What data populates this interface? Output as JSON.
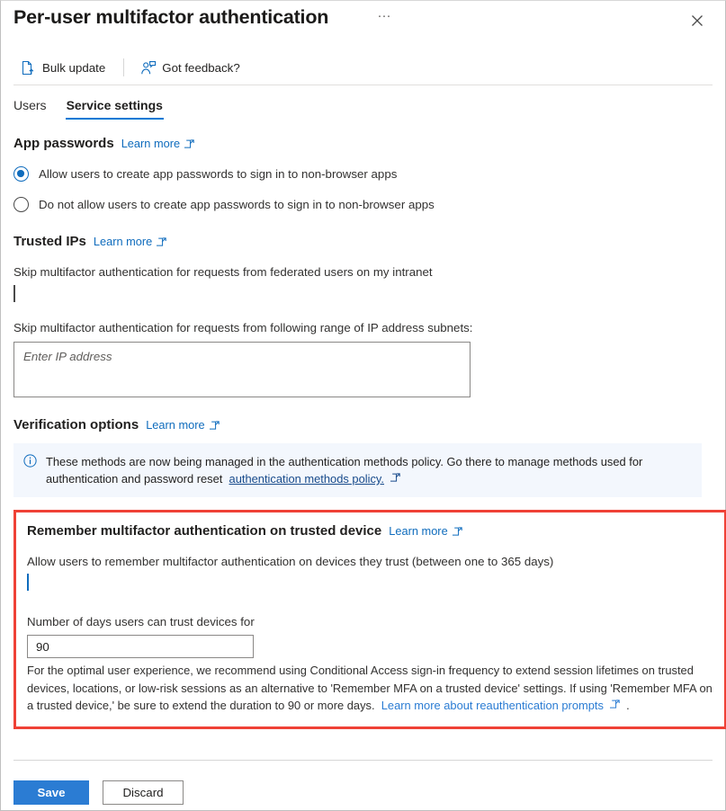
{
  "blade": {
    "title": "Per-user multifactor authentication",
    "more_options_label": "···",
    "close_label": "Close"
  },
  "commandbar": {
    "items": [
      {
        "label": "Bulk update",
        "icon": "document-upload-icon"
      },
      {
        "label": "Got feedback?",
        "icon": "person-feedback-icon"
      }
    ]
  },
  "tabs": [
    {
      "label": "Users",
      "active": false
    },
    {
      "label": "Service settings",
      "active": true
    }
  ],
  "app_passwords": {
    "title": "App passwords",
    "learn_more": "Learn more",
    "options": [
      {
        "label": "Allow users to create app passwords to sign in to non-browser apps",
        "selected": true
      },
      {
        "label": "Do not allow users to create app passwords to sign in to non-browser apps",
        "selected": false
      }
    ]
  },
  "trusted_ips": {
    "title": "Trusted IPs",
    "learn_more": "Learn more",
    "federated_checkbox_label": "Skip multifactor authentication for requests from federated users on my intranet",
    "federated_checkbox_checked": false,
    "subnets_label": "Skip multifactor authentication for requests from following range of IP address subnets:",
    "subnets_value": "",
    "subnets_placeholder": "Enter IP address"
  },
  "verification_options": {
    "title": "Verification options",
    "learn_more": "Learn more",
    "banner": {
      "icon": "info-icon",
      "text_before": "These methods are now being managed in the authentication methods policy. Go there to manage methods used for authentication and password reset",
      "link_text": "authentication methods policy."
    }
  },
  "remember_mfa": {
    "title": "Remember multifactor authentication on trusted device",
    "learn_more": "Learn more",
    "allow_label": "Allow users to remember multifactor authentication on devices they trust (between one to 365 days)",
    "allow_checked": true,
    "days_label": "Number of days users can trust devices for",
    "days_value": "90",
    "note_text": "For the optimal user experience, we recommend using Conditional Access sign-in frequency to extend session lifetimes on trusted devices, locations, or low-risk sessions as an alternative to 'Remember MFA on a trusted device' settings. If using 'Remember MFA on a trusted device,' be sure to extend the duration to 90 or more days.",
    "note_link": "Learn more about reauthentication prompts",
    "note_period": ".",
    "highlight_color": "#ef4136"
  },
  "footer": {
    "save_label": "Save",
    "discard_label": "Discard"
  },
  "colors": {
    "accent": "#0078d4",
    "link": "#0f6cbd",
    "primary_button": "#2b7cd3",
    "highlight": "#ef4136",
    "banner_bg": "#f3f7fd"
  }
}
